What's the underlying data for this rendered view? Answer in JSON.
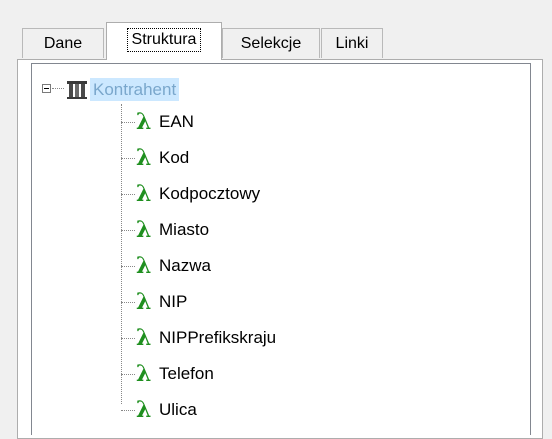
{
  "tabs": [
    {
      "label": "Dane",
      "active": false
    },
    {
      "label": "Struktura",
      "active": true
    },
    {
      "label": "Selekcje",
      "active": false
    },
    {
      "label": "Linki",
      "active": false
    }
  ],
  "tree": {
    "root": {
      "label": "Kontrahent",
      "icon": "table-icon",
      "expanded": true,
      "selected": true
    },
    "children": [
      {
        "label": "EAN",
        "icon": "lambda-icon"
      },
      {
        "label": "Kod",
        "icon": "lambda-icon"
      },
      {
        "label": "Kodpocztowy",
        "icon": "lambda-icon"
      },
      {
        "label": "Miasto",
        "icon": "lambda-icon"
      },
      {
        "label": "Nazwa",
        "icon": "lambda-icon"
      },
      {
        "label": "NIP",
        "icon": "lambda-icon"
      },
      {
        "label": "NIPPrefikskraju",
        "icon": "lambda-icon"
      },
      {
        "label": "Telefon",
        "icon": "lambda-icon"
      },
      {
        "label": "Ulica",
        "icon": "lambda-icon"
      }
    ]
  },
  "colors": {
    "selection_bg": "#cce8ff",
    "selection_text": "#7aa7cc",
    "lambda": "#1f8f1f"
  }
}
